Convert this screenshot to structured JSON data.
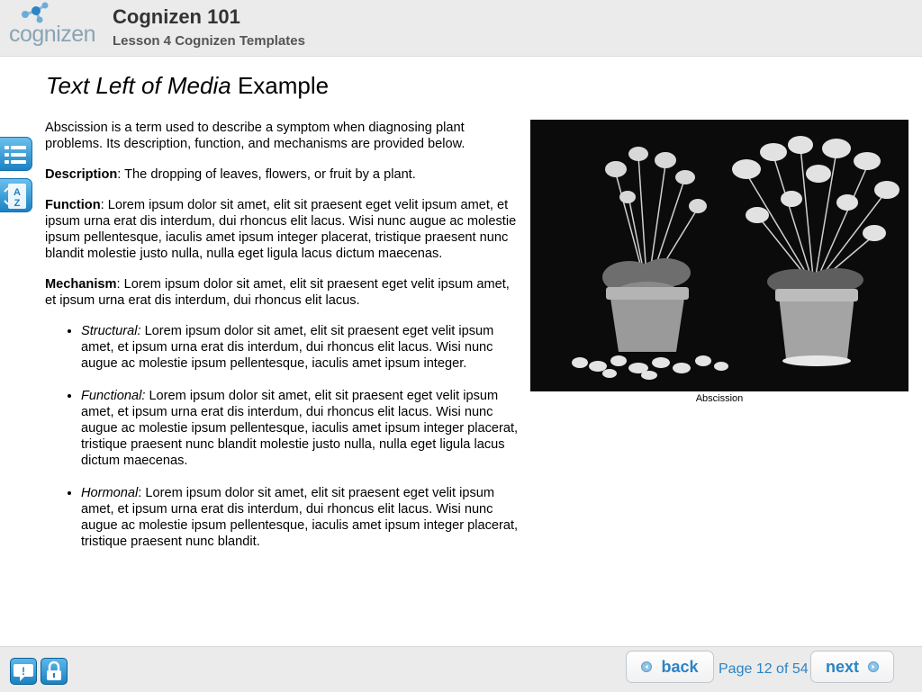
{
  "header": {
    "logo_text": "cognizen",
    "course_title": "Cognizen 101",
    "lesson_title": "Lesson 4 Cognizen Templates"
  },
  "page": {
    "heading_italic": "Text Left of Media",
    "heading_rest": " Example"
  },
  "side_tools": [
    {
      "icon": "list-icon",
      "name": "index"
    },
    {
      "icon": "a-z-glossary-icon",
      "name": "glossary"
    }
  ],
  "content": {
    "intro": "Abscission is a term used to describe a symptom when diagnosing plant problems. Its description, function, and mechanisms are provided below.",
    "description_label": "Description",
    "description_text": ": The dropping of leaves, flowers, or fruit by a plant.",
    "function_label": "Function",
    "function_text": ": Lorem ipsum dolor sit amet, elit sit praesent eget velit ipsum amet, et ipsum urna erat dis interdum, dui rhoncus elit lacus. Wisi nunc augue ac molestie ipsum pellentesque, iaculis amet ipsum integer placerat, tristique praesent nunc blandit molestie justo nulla, nulla eget ligula lacus dictum maecenas.",
    "mechanism_label": "Mechanism",
    "mechanism_text": ": Lorem ipsum dolor sit amet, elit sit praesent eget velit ipsum amet, et ipsum urna erat dis interdum, dui rhoncus elit lacus.",
    "bullets": [
      {
        "label": "Structural:",
        "text": " Lorem ipsum dolor sit amet, elit sit praesent eget velit ipsum amet, et ipsum urna erat dis interdum, dui rhoncus elit lacus. Wisi nunc augue ac molestie ipsum pellentesque, iaculis amet ipsum integer."
      },
      {
        "label": "Functional:",
        "text": " Lorem ipsum dolor sit amet, elit sit praesent eget velit ipsum amet, et ipsum urna erat dis interdum, dui rhoncus elit lacus. Wisi nunc augue ac molestie ipsum pellentesque, iaculis amet ipsum integer placerat, tristique praesent nunc blandit molestie justo nulla, nulla eget ligula lacus dictum maecenas."
      },
      {
        "label": "Hormonal",
        "text": ": Lorem ipsum dolor sit amet, elit sit praesent eget velit ipsum amet, et ipsum urna erat dis interdum, dui rhoncus elit lacus. Wisi nunc augue ac molestie ipsum pellentesque, iaculis amet ipsum integer placerat, tristique praesent nunc blandit."
      }
    ]
  },
  "media": {
    "caption": "Abscission"
  },
  "footer": {
    "help_icon": "help-speech-icon",
    "lock_icon": "lock-icon",
    "back_label": "back",
    "next_label": "next",
    "page_counter": "Page 12 of 54"
  },
  "colors": {
    "accent_blue": "#2a84c6",
    "header_bg": "#ebebeb"
  }
}
